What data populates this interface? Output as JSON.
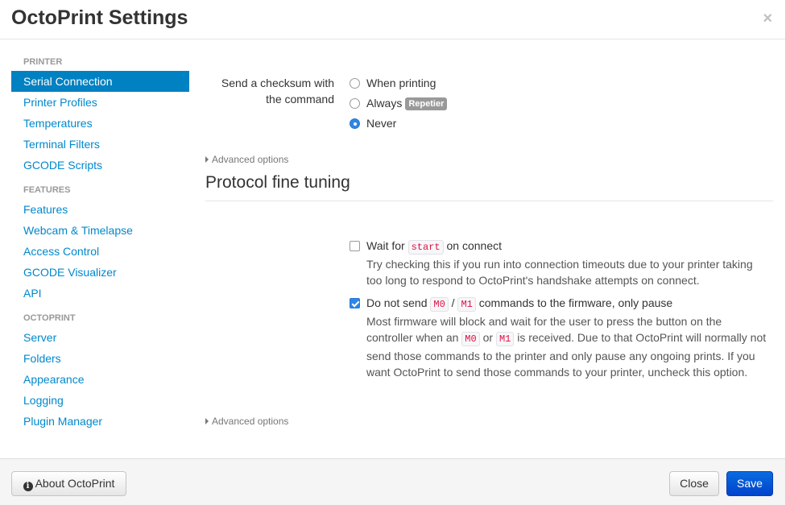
{
  "header": {
    "title": "OctoPrint Settings",
    "close_glyph": "×"
  },
  "sidebar": {
    "groups": [
      {
        "header": "PRINTER",
        "items": [
          "Serial Connection",
          "Printer Profiles",
          "Temperatures",
          "Terminal Filters",
          "GCODE Scripts"
        ]
      },
      {
        "header": "FEATURES",
        "items": [
          "Features",
          "Webcam & Timelapse",
          "Access Control",
          "GCODE Visualizer",
          "API"
        ]
      },
      {
        "header": "OCTOPRINT",
        "items": [
          "Server",
          "Folders",
          "Appearance",
          "Logging",
          "Plugin Manager"
        ]
      }
    ],
    "active_item": "Serial Connection"
  },
  "checksum": {
    "label_line1": "Send a checksum with",
    "label_line2": "the command",
    "options": [
      {
        "label": "When printing",
        "checked": false
      },
      {
        "label": "Always",
        "badge": "Repetier",
        "checked": false
      },
      {
        "label": "Never",
        "checked": true
      }
    ]
  },
  "advanced_label_1": "Advanced options",
  "section_title": "Protocol fine tuning",
  "wait_start": {
    "checked": false,
    "prefix": "Wait for ",
    "code": "start",
    "suffix": " on connect",
    "help": "Try checking this if you run into connection timeouts due to your printer taking too long to respond to OctoPrint's handshake attempts on connect."
  },
  "no_m0m1": {
    "checked": true,
    "prefix": "Do not send ",
    "code1": "M0",
    "sep": " / ",
    "code2": "M1",
    "suffix": " commands to the firmware, only pause",
    "help_part1": "Most firmware will block and wait for the user to press the button on the controller when an ",
    "help_code1": "M0",
    "help_or": " or ",
    "help_code2": "M1",
    "help_part2": " is received. Due to that OctoPrint will normally not send those commands to the printer and only pause any ongoing prints. If you want OctoPrint to send those commands to your printer, uncheck this option."
  },
  "advanced_label_2": "Advanced options",
  "footer": {
    "about_label": "About OctoPrint",
    "close_label": "Close",
    "save_label": "Save"
  },
  "colors": {
    "active_nav_bg": "#0081c2",
    "link": "#0088cc",
    "primary_button": "#0044cc",
    "badge": "#999999",
    "code_text": "#dd1144"
  },
  "icons": {
    "about": "info-circle-icon"
  }
}
